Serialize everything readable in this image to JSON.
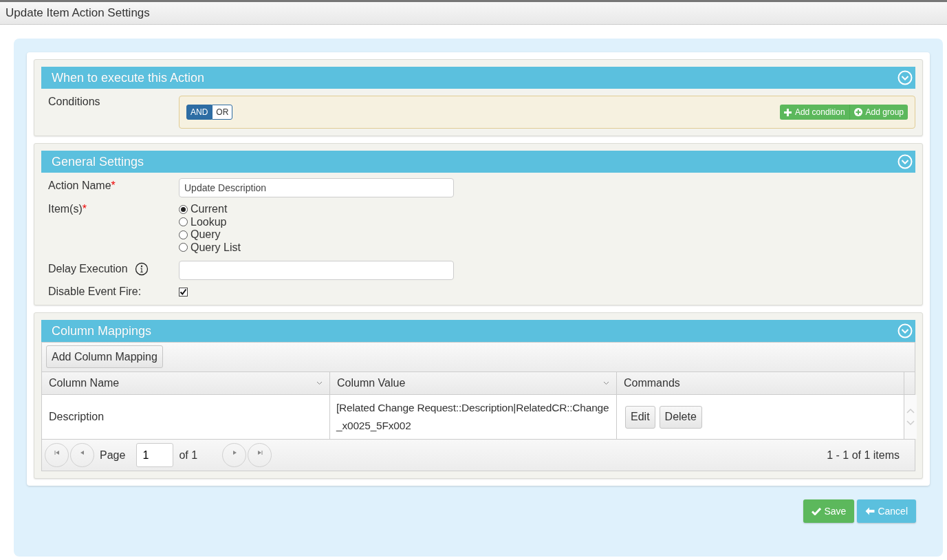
{
  "window": {
    "title": "Update Item Action Settings"
  },
  "sections": [
    {
      "title": "When to execute this Action",
      "kind": "conditions",
      "label": "Conditions",
      "logic": [
        {
          "label": "AND",
          "selected": true
        },
        {
          "label": "OR",
          "selected": false
        }
      ],
      "buttons": [
        {
          "label": "Add condition",
          "kind": "condition"
        },
        {
          "label": "Add group",
          "kind": "group"
        }
      ]
    },
    {
      "title": "General Settings",
      "kind": "settings",
      "fields": [
        {
          "kind": "text",
          "label": "Action Name",
          "required_mark": "*",
          "value": "Update Description"
        },
        {
          "kind": "radio",
          "label": "Item(s)",
          "required_mark": "*",
          "options": [
            {
              "label": "Current",
              "selected": true
            },
            {
              "label": "Lookup",
              "selected": false
            },
            {
              "label": "Query",
              "selected": false
            },
            {
              "label": "Query List",
              "selected": false
            }
          ]
        },
        {
          "kind": "text",
          "label": "Delay Execution",
          "info": true
        },
        {
          "kind": "checkbox",
          "label": "Disable Event Fire:",
          "checked": true
        }
      ]
    },
    {
      "title": "Column Mappings",
      "kind": "grid",
      "toolbar_button": "Add Column Mapping",
      "columns": [
        {
          "label": "Column Name",
          "menu": true
        },
        {
          "label": "Column Value",
          "menu": true
        },
        {
          "label": "Commands",
          "menu": false
        }
      ],
      "rows": [
        {
          "name": "Description",
          "value": "[Related Change Request::Description|RelatedCR::Change_x0025_5Fx002",
          "commands": [
            "Edit",
            "Delete"
          ]
        }
      ],
      "pager": {
        "page_label": "Page",
        "page": "1",
        "of": "of 1",
        "summary": "1 - 1 of 1 items"
      }
    }
  ],
  "footer": {
    "save": "Save",
    "cancel": "Cancel"
  }
}
